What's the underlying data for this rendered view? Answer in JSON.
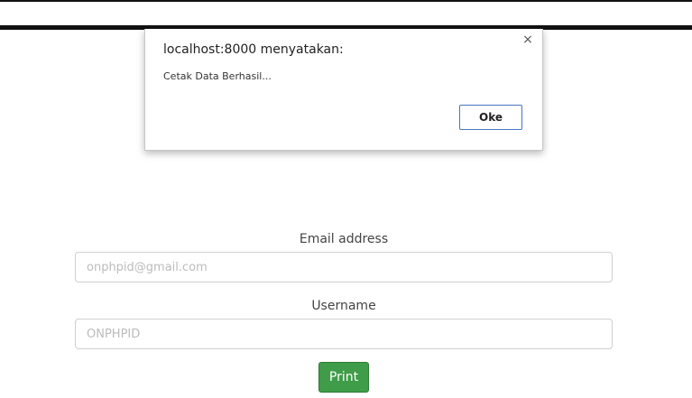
{
  "dialog": {
    "title": "localhost:8000 menyatakan:",
    "message": "Cetak Data Berhasil...",
    "ok_label": "Oke",
    "close_glyph": "×",
    "close_icon": "close-icon"
  },
  "form": {
    "email": {
      "label": "Email address",
      "placeholder": "onphpid@gmail.com"
    },
    "username": {
      "label": "Username",
      "placeholder": "ONPHPID"
    },
    "print_label": "Print"
  },
  "colors": {
    "print_button": "#3f9c48",
    "ok_border": "#4a76c4"
  }
}
